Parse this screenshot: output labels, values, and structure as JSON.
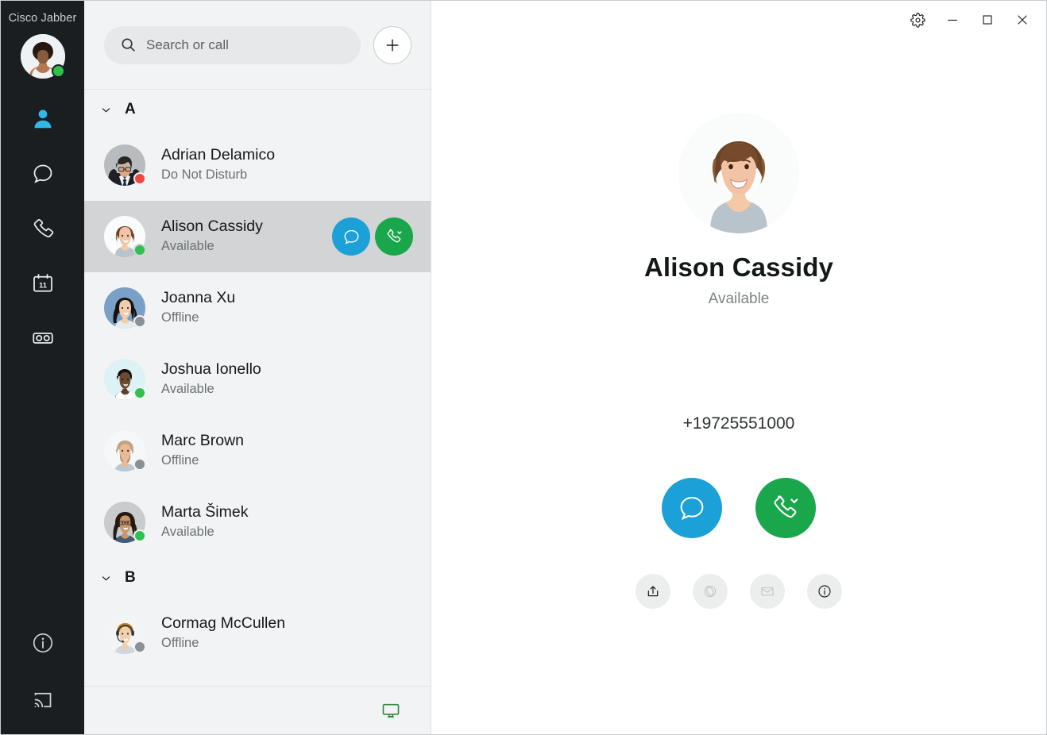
{
  "app": {
    "title": "Cisco Jabber",
    "self_status": "available",
    "self_status_color": "#2fc04e"
  },
  "rail": {
    "items": [
      {
        "name": "contacts",
        "icon": "person-icon",
        "active": true
      },
      {
        "name": "chats",
        "icon": "chat-bubble-icon",
        "active": false
      },
      {
        "name": "calls",
        "icon": "phone-icon",
        "active": false
      },
      {
        "name": "meetings",
        "icon": "calendar-icon",
        "active": false,
        "badge": "11"
      },
      {
        "name": "voicemail",
        "icon": "voicemail-icon",
        "active": false
      }
    ],
    "bottom_items": [
      {
        "name": "info",
        "icon": "info-circle-icon"
      },
      {
        "name": "share-screen",
        "icon": "cast-screen-icon"
      }
    ]
  },
  "search": {
    "placeholder": "Search or call",
    "icon": "search-icon",
    "add_button_icon": "plus-icon"
  },
  "groups": [
    {
      "label": "A",
      "expanded": true,
      "contacts": [
        {
          "name": "Adrian Delamico",
          "status": "Do Not Disturb",
          "status_color": "#f0483e",
          "selected": false,
          "avatar": "man-glasses-suit"
        },
        {
          "name": "Alison Cassidy",
          "status": "Available",
          "status_color": "#2fc04e",
          "selected": true,
          "avatar": "woman-curly-hair",
          "actions": [
            {
              "name": "chat",
              "icon": "chat-bubble-icon",
              "color": "#1ba0d7"
            },
            {
              "name": "call",
              "icon": "phone-chevron-icon",
              "color": "#1aa64b"
            }
          ]
        },
        {
          "name": "Joanna Xu",
          "status": "Offline",
          "status_color": "#8a9093",
          "selected": false,
          "avatar": "woman-dark-hair-blue"
        },
        {
          "name": "Joshua Ionello",
          "status": "Available",
          "status_color": "#2fc04e",
          "selected": false,
          "avatar": "man-white-shirt"
        },
        {
          "name": "Marc Brown",
          "status": "Offline",
          "status_color": "#8a9093",
          "selected": false,
          "avatar": "man-beard"
        },
        {
          "name": "Marta Šimek",
          "status": "Available",
          "status_color": "#2fc04e",
          "selected": false,
          "avatar": "woman-glasses"
        }
      ]
    },
    {
      "label": "B",
      "expanded": true,
      "contacts": [
        {
          "name": "Cormag McCullen",
          "status": "Offline",
          "status_color": "#8a9093",
          "selected": false,
          "avatar": "man-headset"
        }
      ]
    }
  ],
  "list_footer": {
    "icon": "desk-phone-monitor-icon",
    "icon_color": "#2e8b41"
  },
  "window_controls": [
    {
      "name": "settings",
      "icon": "gear-icon"
    },
    {
      "name": "minimize",
      "icon": "minimize-icon"
    },
    {
      "name": "maximize",
      "icon": "maximize-icon"
    },
    {
      "name": "close",
      "icon": "close-icon"
    }
  ],
  "detail": {
    "name": "Alison Cassidy",
    "status": "Available",
    "phone": "+19725551000",
    "avatar": "woman-curly-hair",
    "primary_actions": [
      {
        "name": "chat",
        "icon": "chat-bubble-icon",
        "color": "#1ba0d7"
      },
      {
        "name": "call",
        "icon": "phone-chevron-icon",
        "color": "#1aa64b"
      }
    ],
    "secondary_actions": [
      {
        "name": "share",
        "icon": "share-upload-icon",
        "enabled": true
      },
      {
        "name": "webex-meeting",
        "icon": "webex-icon",
        "enabled": false
      },
      {
        "name": "email",
        "icon": "envelope-icon",
        "enabled": false
      },
      {
        "name": "contact-info",
        "icon": "info-circle-icon",
        "enabled": true
      }
    ]
  },
  "colors": {
    "rail_bg": "#1b1e21",
    "list_bg": "#f2f3f4",
    "selected_row": "#d2d4d5",
    "accent_blue": "#1ba0d7",
    "accent_green": "#1aa64b",
    "active_icon": "#2fb8e8"
  }
}
